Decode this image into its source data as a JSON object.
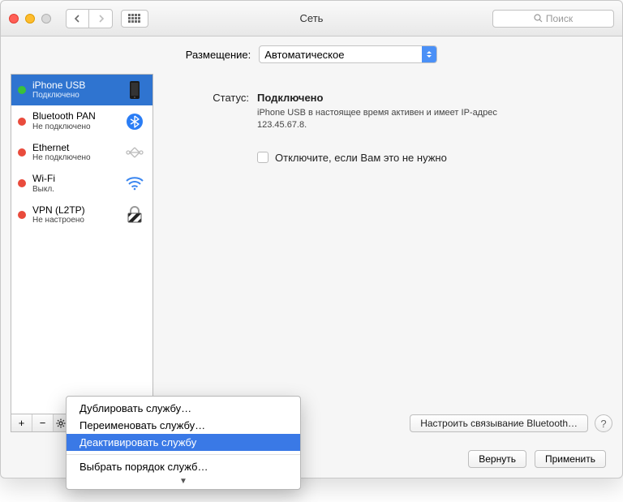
{
  "title": "Сеть",
  "search_placeholder": "Поиск",
  "location": {
    "label": "Размещение:",
    "value": "Автоматическое"
  },
  "sidebar": {
    "items": [
      {
        "name": "iPhone USB",
        "status": "Подключено",
        "dot": "green",
        "selected": true,
        "icon": "phone"
      },
      {
        "name": "Bluetooth PAN",
        "status": "Не подключено",
        "dot": "red",
        "selected": false,
        "icon": "bluetooth"
      },
      {
        "name": "Ethernet",
        "status": "Не подключено",
        "dot": "red",
        "selected": false,
        "icon": "ethernet"
      },
      {
        "name": "Wi-Fi",
        "status": "Выкл.",
        "dot": "red",
        "selected": false,
        "icon": "wifi"
      },
      {
        "name": "VPN (L2TP)",
        "status": "Не настроено",
        "dot": "red",
        "selected": false,
        "icon": "lock"
      }
    ],
    "toolbar": {
      "add": "+",
      "remove": "−",
      "gear": "⚙︎"
    }
  },
  "detail": {
    "status_label": "Статус:",
    "status_value": "Подключено",
    "status_desc": "iPhone USB  в настоящее время активен и имеет IP-адрес 123.45.67.8.",
    "checkbox_label": "Отключите, если Вам это не нужно",
    "configure_btn": "Настроить связывание Bluetooth…",
    "help": "?"
  },
  "footer": {
    "revert": "Вернуть",
    "apply": "Применить"
  },
  "context_menu": {
    "items": [
      "Дублировать службу…",
      "Переименовать службу…",
      "Деактивировать службу"
    ],
    "highlight_index": 2,
    "after_sep": "Выбрать порядок служб…"
  }
}
